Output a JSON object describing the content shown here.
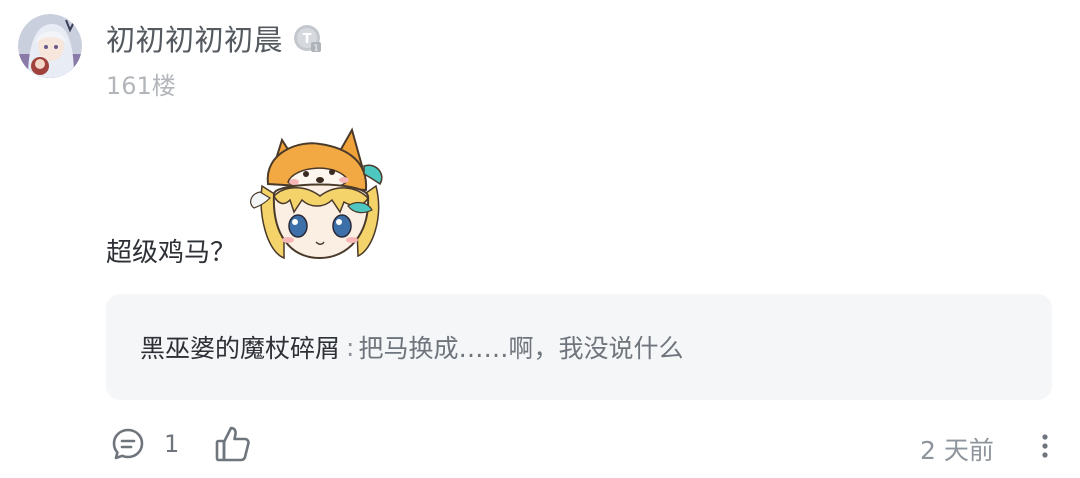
{
  "post": {
    "username": "初初初初初晨",
    "floor": "161楼",
    "content": "超级鸡马？"
  },
  "icons": {
    "avatar": "anime-girl-avatar",
    "level_badge": "level-badge-icon",
    "sticker": "shiba-hat-girl-sticker",
    "comment": "comment-icon",
    "like": "thumbs-up-icon",
    "more": "more-vertical-icon"
  },
  "reply": {
    "username": "黑巫婆的魔杖碎屑",
    "separator": ":",
    "text": "把马换成……啊，我没说什么"
  },
  "actions": {
    "comment_count": "1",
    "time": "2 天前"
  },
  "colors": {
    "username": "#555a60",
    "meta": "#b2b6bb",
    "reply_bg": "#f5f6f8"
  }
}
